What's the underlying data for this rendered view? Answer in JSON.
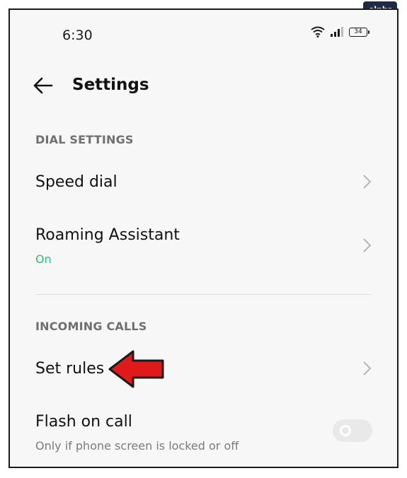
{
  "watermark": "alphr",
  "status_bar": {
    "time": "6:30",
    "battery": "34",
    "icons": [
      "wifi-icon",
      "signal-icon",
      "battery-icon"
    ]
  },
  "header": {
    "back_icon": "arrow-left-icon",
    "title": "Settings"
  },
  "sections": {
    "dial": {
      "header": "DIAL SETTINGS",
      "items": {
        "speed_dial": {
          "label": "Speed dial"
        },
        "roaming": {
          "label": "Roaming Assistant",
          "sub": "On"
        }
      }
    },
    "incoming": {
      "header": "INCOMING CALLS",
      "items": {
        "set_rules": {
          "label": "Set rules"
        },
        "flash": {
          "label": "Flash on call",
          "sub": "Only if phone screen is locked or off",
          "toggle_on": false
        }
      }
    }
  },
  "colors": {
    "accent_green": "#2fbf71",
    "annotation_arrow": "#e0191b"
  }
}
